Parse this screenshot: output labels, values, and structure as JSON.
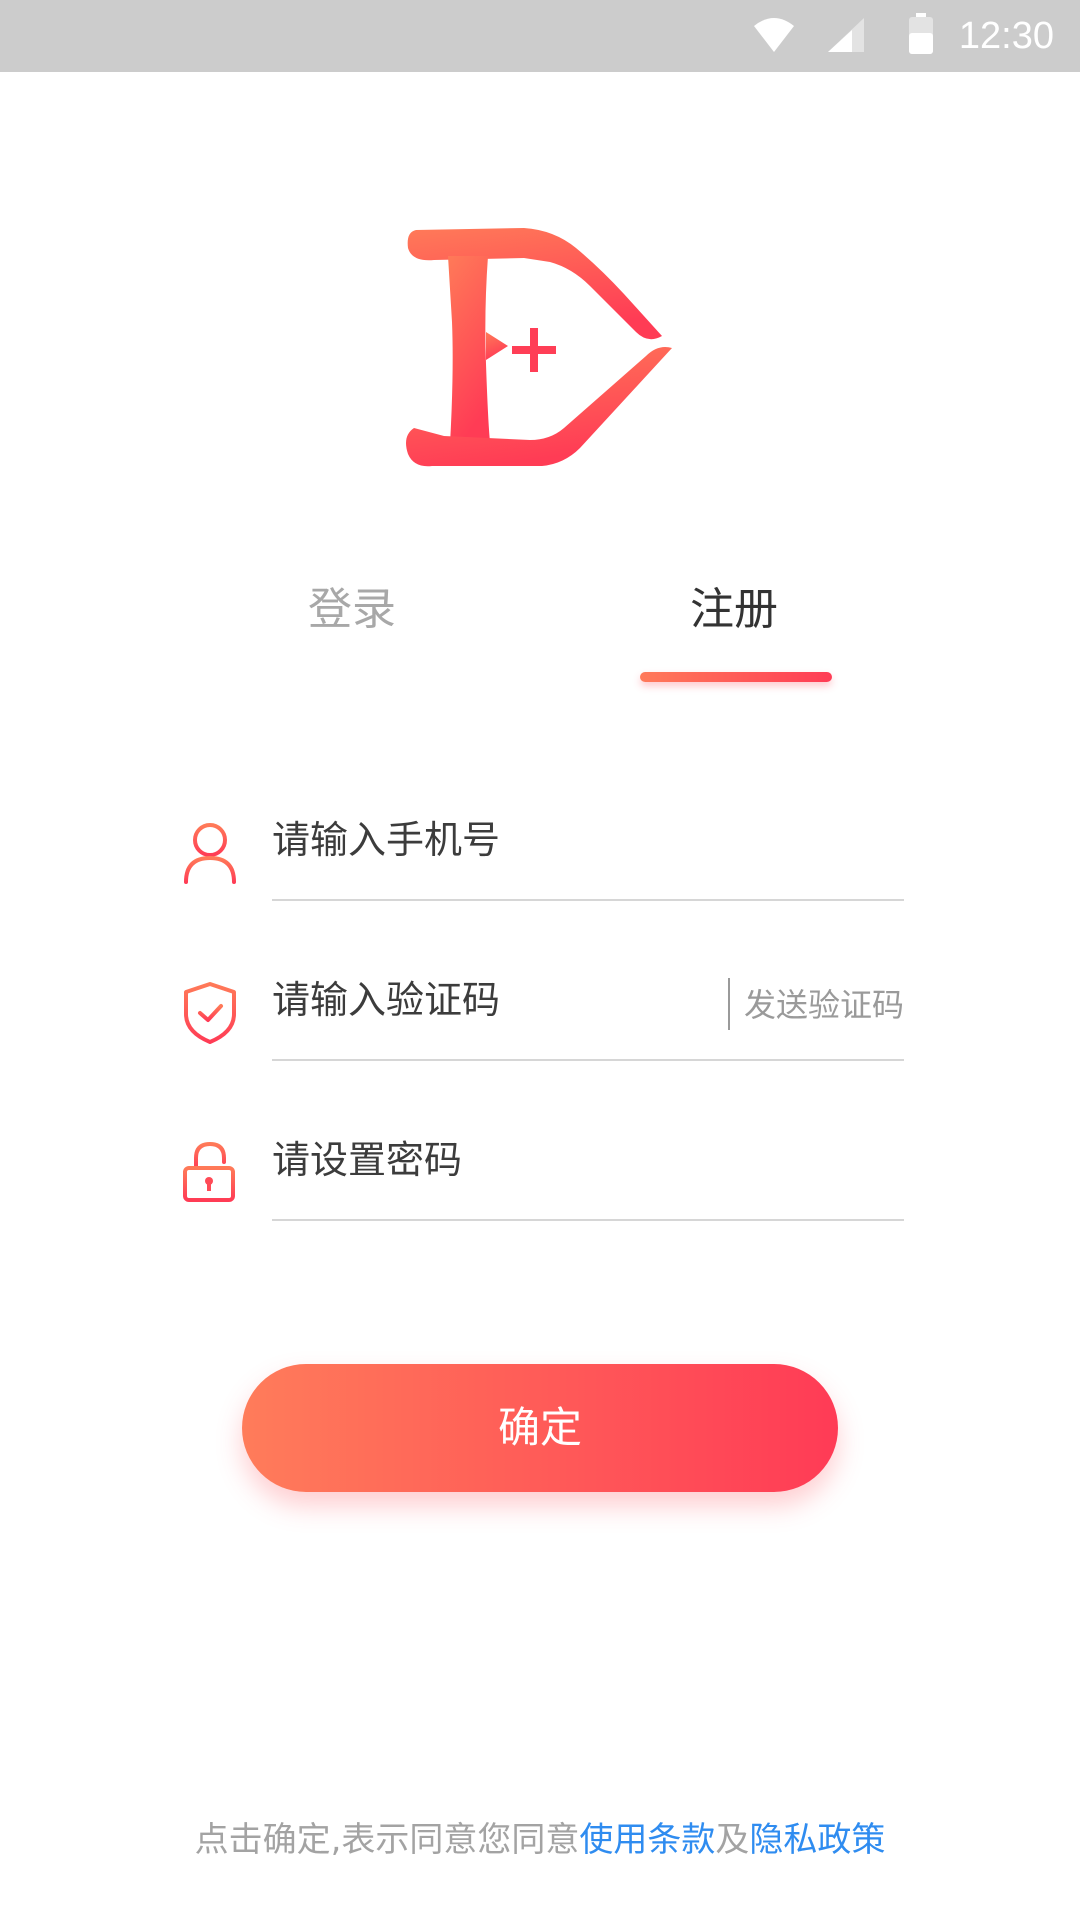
{
  "status_bar": {
    "time": "12:30",
    "icons": [
      "wifi-icon",
      "signal-icon",
      "battery-icon"
    ]
  },
  "logo": {
    "icon": "logo-d-plus-icon"
  },
  "tabs": [
    {
      "label": "登录",
      "active": false
    },
    {
      "label": "注册",
      "active": true
    }
  ],
  "form": {
    "phone": {
      "placeholder": "请输入手机号",
      "value": "",
      "icon": "user-icon"
    },
    "code": {
      "placeholder": "请输入验证码",
      "value": "",
      "icon": "shield-check-icon",
      "send_label": "发送验证码"
    },
    "password": {
      "placeholder": "请设置密码",
      "value": "",
      "icon": "lock-icon"
    }
  },
  "confirm": {
    "label": "确定"
  },
  "agreement": {
    "prefix": "点击确定,表示同意您同意",
    "terms": "使用条款",
    "and": "及",
    "privacy": "隐私政策"
  },
  "colors": {
    "accent_start": "#ff7c5a",
    "accent_end": "#ff3b56",
    "link": "#2f8cf0",
    "status_bar": "#cccccc",
    "muted_text": "#a3a3a3"
  }
}
